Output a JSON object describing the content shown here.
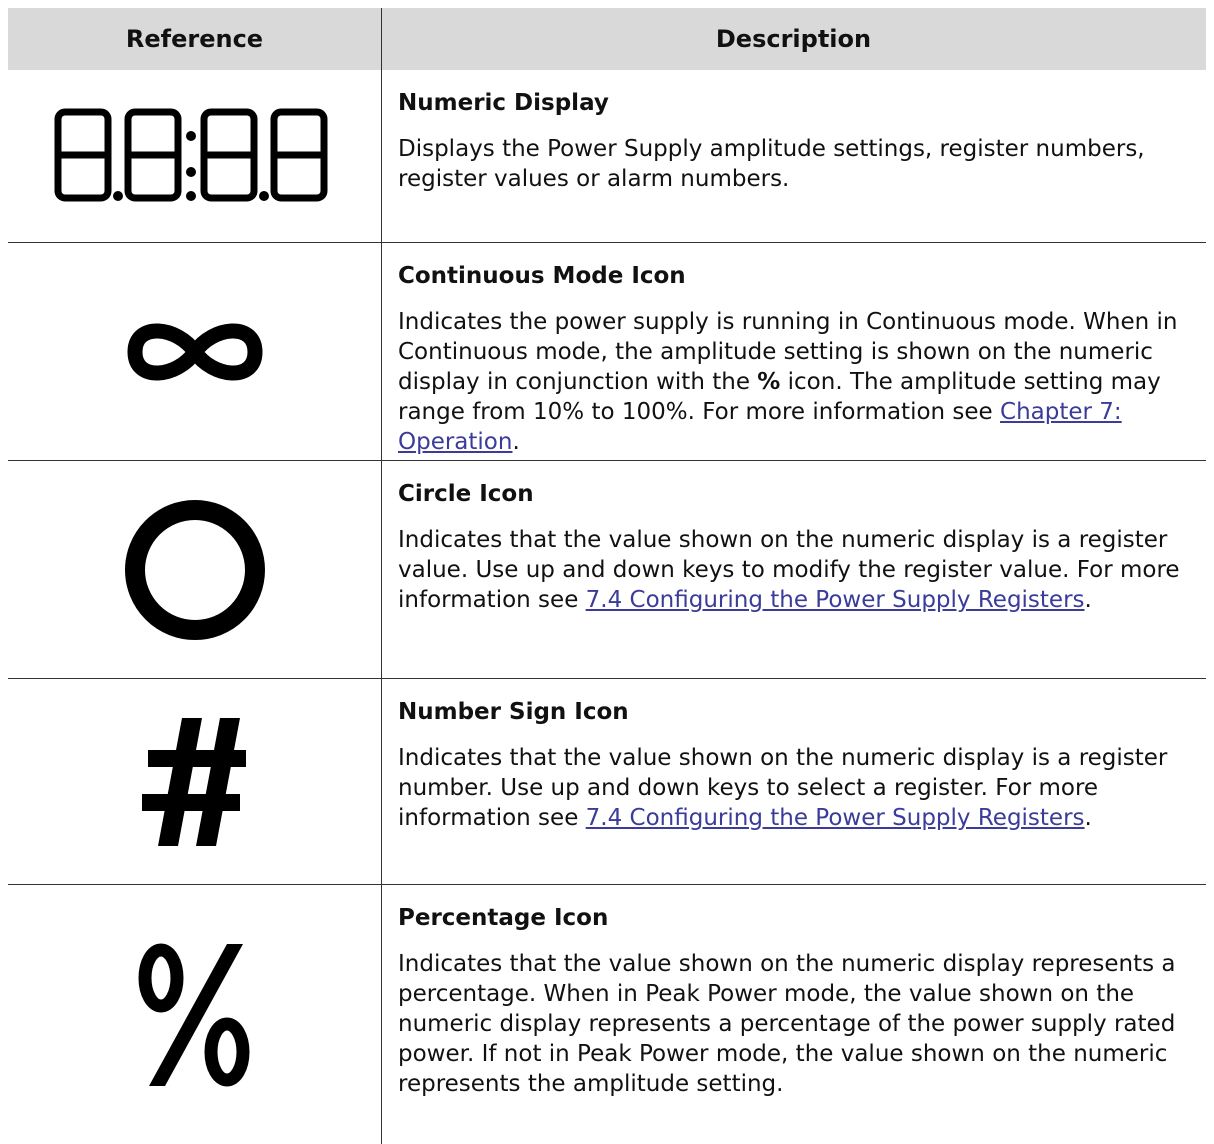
{
  "table": {
    "headers": {
      "reference": "Reference",
      "description": "Description"
    },
    "rows": [
      {
        "icon": "seven-segment-display-icon",
        "title": "Numeric Display",
        "text": "Displays the Power Supply amplitude settings, register numbers, register values or alarm numbers."
      },
      {
        "icon": "infinity-icon",
        "title": "Continuous Mode Icon",
        "text_a": "Indicates the power supply is running in Continuous mode. When in Continuous mode, the amplitude setting is shown on the numeric display in conjunction with the ",
        "bold_symbol": "%",
        "text_b": " icon. The amplitude setting may range from 10% to 100%. For more information see ",
        "link": "Chapter 7: Operation",
        "text_c": "."
      },
      {
        "icon": "circle-icon",
        "title": "Circle Icon",
        "text_a": "Indicates that the value shown on the numeric display is a register value. Use up and down keys to modify the register value. For more information see ",
        "link": "7.4 Configuring the Power Supply Registers",
        "text_c": "."
      },
      {
        "icon": "number-sign-icon",
        "symbol": "#",
        "title": "Number Sign Icon",
        "text_a": "Indicates that the value shown on the numeric display is a register number. Use up and down keys to select a register. For more information see ",
        "link": "7.4 Configuring the Power Supply Registers",
        "text_c": "."
      },
      {
        "icon": "percentage-icon",
        "symbol": "%",
        "title": "Percentage Icon",
        "text": "Indicates that the value shown on the numeric display represents a percentage. When in Peak Power mode, the value shown on the numeric display represents a percentage of the power supply rated power. If not in Peak Power mode, the value shown on the numeric represents the amplitude setting."
      }
    ]
  }
}
